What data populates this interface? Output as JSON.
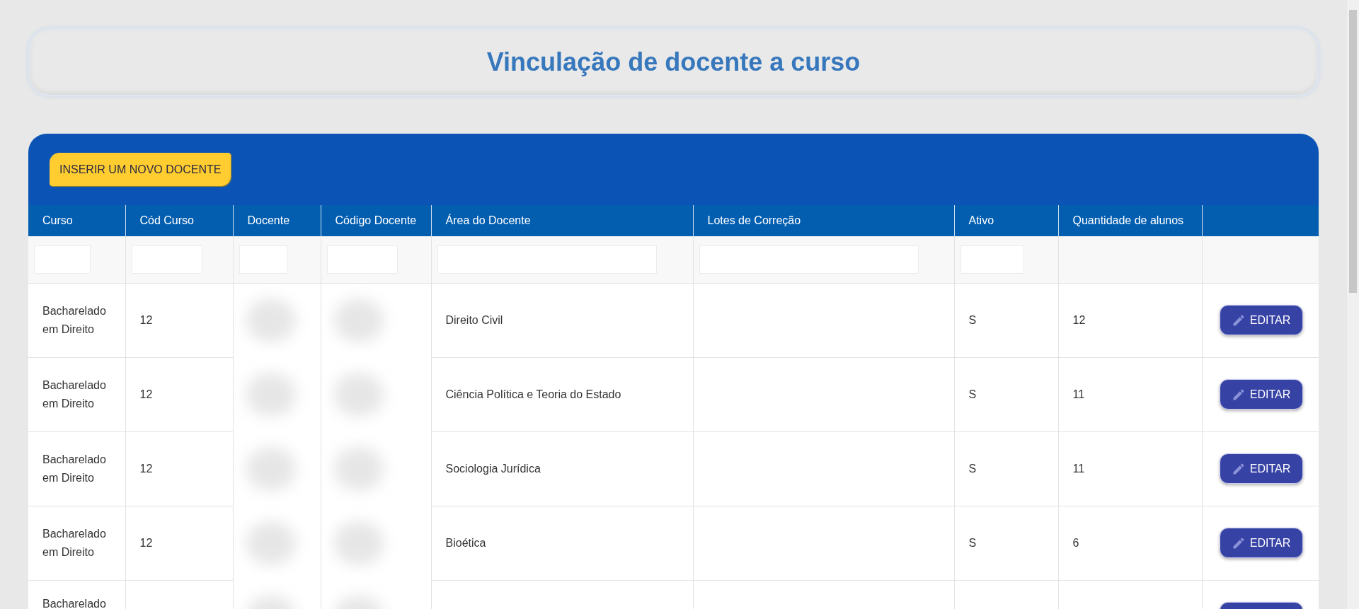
{
  "page_title": "Vinculação de docente a curso",
  "insert_button": "INSERIR UM NOVO DOCENTE",
  "table": {
    "columns": [
      "Curso",
      "Cód Curso",
      "Docente",
      "Código Docente",
      "Área do Docente",
      "Lotes de Correção",
      "Ativo",
      "Quantidade de alunos"
    ],
    "filters": [
      true,
      true,
      true,
      true,
      true,
      true,
      true,
      false,
      false
    ],
    "rows": [
      {
        "curso": "Bacharelado em Direito",
        "cod_curso": "12",
        "area": "Direito Civil",
        "ativo": "S",
        "quantidade": "12",
        "action": {
          "kind": "edit",
          "label": "EDITAR"
        }
      },
      {
        "curso": "Bacharelado em Direito",
        "cod_curso": "12",
        "area": "Ciência Política e Teoria do Estado",
        "ativo": "S",
        "quantidade": "11",
        "action": {
          "kind": "edit",
          "label": "EDITAR"
        }
      },
      {
        "curso": "Bacharelado em Direito",
        "cod_curso": "12",
        "area": "Sociologia Jurídica",
        "ativo": "S",
        "quantidade": "11",
        "action": {
          "kind": "edit",
          "label": "EDITAR"
        }
      },
      {
        "curso": "Bacharelado em Direito",
        "cod_curso": "12",
        "area": "Bioética",
        "ativo": "S",
        "quantidade": "6",
        "action": {
          "kind": "edit",
          "label": "EDITAR"
        }
      },
      {
        "curso": "Bacharelado",
        "action": {
          "kind": "edit"
        }
      }
    ]
  }
}
